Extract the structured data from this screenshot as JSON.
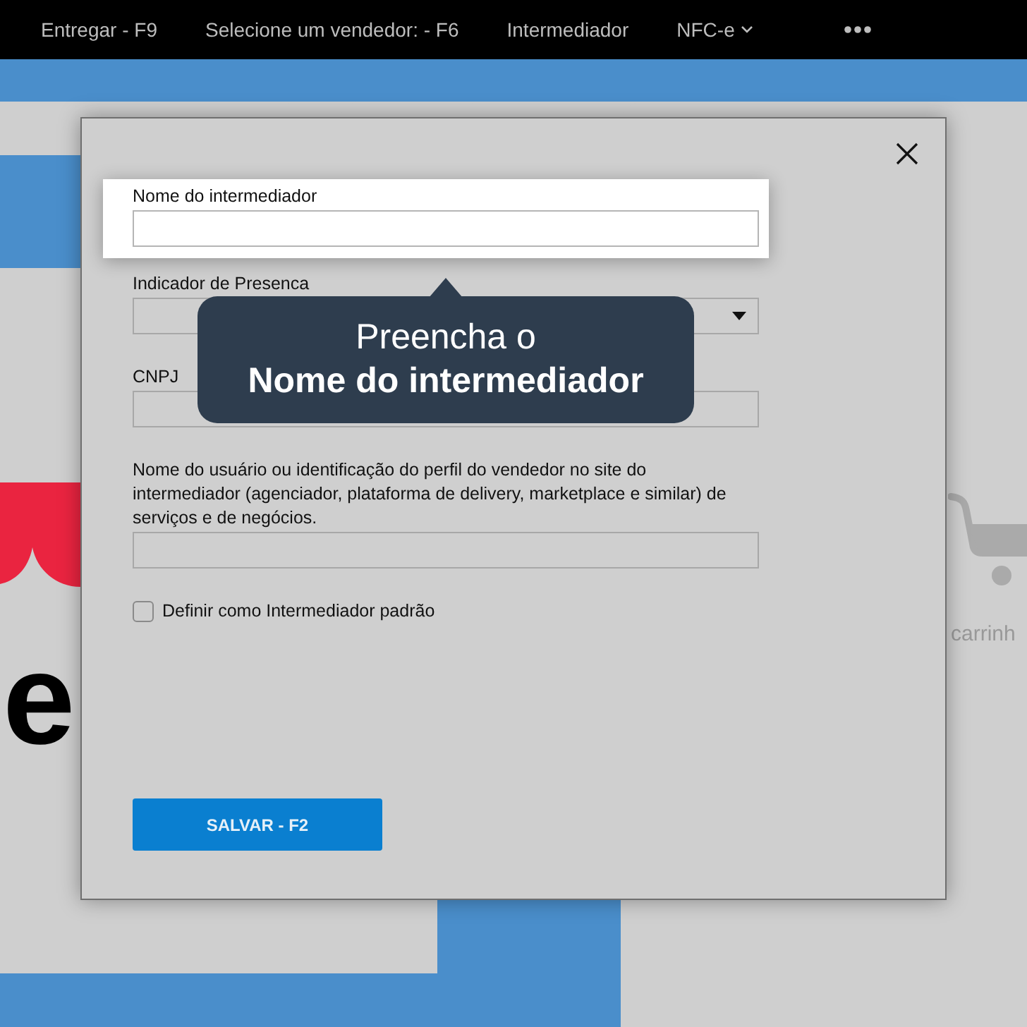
{
  "nav": {
    "items": [
      {
        "kind": "text",
        "label": "Entregar - F9"
      },
      {
        "kind": "text",
        "label": "Selecione um vendedor: - F6"
      },
      {
        "kind": "text",
        "label": "Intermediador"
      },
      {
        "kind": "dropdown",
        "label": "NFC-e"
      },
      {
        "kind": "more"
      }
    ]
  },
  "background": {
    "logo_text": "e",
    "cart_caption": "carrinh"
  },
  "modal": {
    "fields": [
      {
        "kind": "text",
        "label": "Nome do intermediador",
        "highlighted": true
      },
      {
        "kind": "select",
        "label": "Indicador de Presenca",
        "highlighted": false
      },
      {
        "kind": "text",
        "label": "CNPJ",
        "highlighted": false
      },
      {
        "kind": "text",
        "label": "Nome do usuário ou identificação do perfil do vendedor no site do intermediador (agenciador, plataforma de delivery, marketplace e similar) de serviços e de negócios.",
        "highlighted": false
      }
    ],
    "checkbox": {
      "label": "Definir como Intermediador padrão",
      "checked": false
    },
    "button": "SALVAR - F2"
  },
  "tooltip": {
    "line1": "Preencha o",
    "line2": "Nome do intermediador"
  }
}
